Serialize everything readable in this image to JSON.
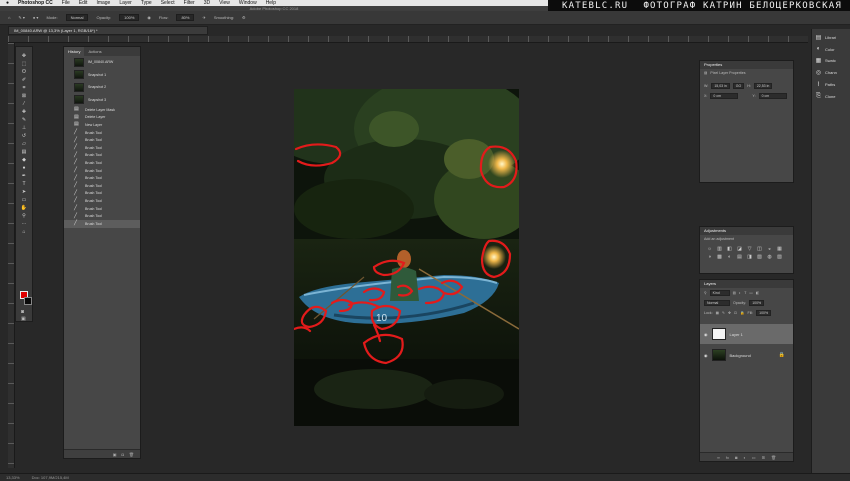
{
  "menubar": {
    "app": "Photoshop CC",
    "items": [
      "File",
      "Edit",
      "Image",
      "Layer",
      "Type",
      "Select",
      "Filter",
      "3D",
      "View",
      "Window",
      "Help"
    ]
  },
  "watermark": {
    "site": "KATEBLC.RU",
    "author": "ФОТОГРАФ КАТРИН БЕЛОЦЕРКОВСКАЯ"
  },
  "window": {
    "title": "Adobe Photoshop CC 2018"
  },
  "options_bar": {
    "mode_label": "Mode:",
    "mode_value": "Normal",
    "opacity_label": "Opacity:",
    "opacity_value": "100%",
    "flow_label": "Flow:",
    "flow_value": "80%",
    "smoothing_label": "Smoothing:"
  },
  "document": {
    "tab_title": "IM_00840.ARW @ 13,3% (Layer 1, RGB/16*) *"
  },
  "history_panel": {
    "tabs": [
      "History",
      "Actions"
    ],
    "items": [
      {
        "label": "IM_00840.ARW",
        "kind": "snapshot"
      },
      {
        "label": "Snapshot 1",
        "kind": "snapshot"
      },
      {
        "label": "Snapshot 2",
        "kind": "snapshot"
      },
      {
        "label": "Snapshot 3",
        "kind": "snapshot"
      },
      {
        "label": "Delete Layer Mask",
        "kind": "step"
      },
      {
        "label": "Delete Layer",
        "kind": "step"
      },
      {
        "label": "New Layer",
        "kind": "step"
      },
      {
        "label": "Brush Tool",
        "kind": "brush"
      },
      {
        "label": "Brush Tool",
        "kind": "brush"
      },
      {
        "label": "Brush Tool",
        "kind": "brush"
      },
      {
        "label": "Brush Tool",
        "kind": "brush"
      },
      {
        "label": "Brush Tool",
        "kind": "brush"
      },
      {
        "label": "Brush Tool",
        "kind": "brush"
      },
      {
        "label": "Brush Tool",
        "kind": "brush"
      },
      {
        "label": "Brush Tool",
        "kind": "brush"
      },
      {
        "label": "Brush Tool",
        "kind": "brush"
      },
      {
        "label": "Brush Tool",
        "kind": "brush"
      },
      {
        "label": "Brush Tool",
        "kind": "brush"
      },
      {
        "label": "Brush Tool",
        "kind": "brush"
      },
      {
        "label": "Brush Tool",
        "kind": "brush",
        "selected": true
      }
    ]
  },
  "properties_panel": {
    "title": "Properties",
    "subtitle": "Pixel Layer Properties",
    "w_label": "W:",
    "w_value": "15,03 in",
    "go_label": "GO",
    "h_label": "H:",
    "h_value": "22,53 in",
    "x_label": "X:",
    "x_value": "0 cm",
    "y_label": "Y:",
    "y_value": "0 cm"
  },
  "adjustments_panel": {
    "title": "Adjustments",
    "subtitle": "Add an adjustment",
    "icons": [
      "☼",
      "▥",
      "◧",
      "◪",
      "▽",
      "◫",
      "◒",
      "▦",
      "◑",
      "▩",
      "◐",
      "▤",
      "◨",
      "▧",
      "◍",
      "▨"
    ]
  },
  "layers_panel": {
    "title": "Layers",
    "kind_label": "Kind",
    "blend_mode": "Normal",
    "opacity_label": "Opacity:",
    "opacity_value": "100%",
    "lock_label": "Lock:",
    "fill_label": "Fill:",
    "fill_value": "100%",
    "layers": [
      {
        "name": "Layer 1",
        "selected": true
      },
      {
        "name": "Background",
        "locked": true
      }
    ]
  },
  "right_dock": {
    "items": [
      {
        "icon": "library-icon",
        "glyph": "▤",
        "label": "Librari"
      },
      {
        "icon": "color-icon",
        "glyph": "◐",
        "label": "Color"
      },
      {
        "icon": "swatches-icon",
        "glyph": "▦",
        "label": "Swatc"
      },
      {
        "icon": "channels-icon",
        "glyph": "◎",
        "label": "Chann"
      },
      {
        "icon": "paths-icon",
        "glyph": "⌇",
        "label": "Paths"
      },
      {
        "icon": "clone-source-icon",
        "glyph": "⎘",
        "label": "Clone"
      }
    ]
  },
  "status_bar": {
    "zoom": "13,33%",
    "doc_info": "Doc: 107,9M/215,4M"
  }
}
